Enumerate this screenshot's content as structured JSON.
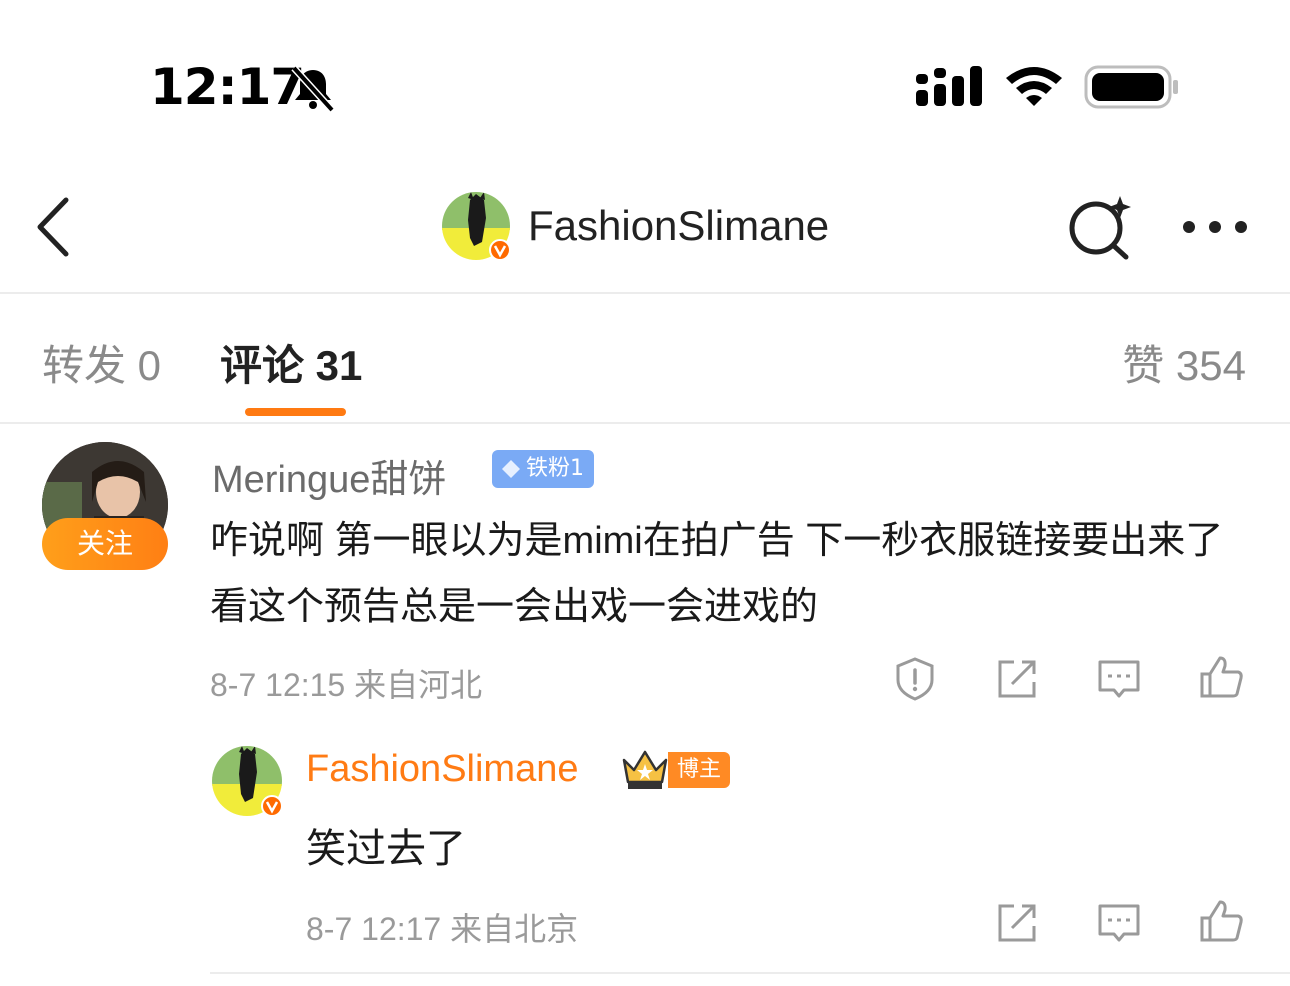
{
  "status_bar": {
    "time": "12:17",
    "icons": [
      "bell-slash-icon",
      "cellular-signal-icon",
      "wifi-icon",
      "battery-icon"
    ]
  },
  "nav": {
    "title": "FashionSlimane",
    "icons": [
      "back-chevron-icon",
      "search-sparkle-icon",
      "more-icon"
    ]
  },
  "tabs": [
    {
      "label": "转发 0",
      "active": false
    },
    {
      "label": "评论 31",
      "active": true
    },
    {
      "label": "赞 354",
      "active": false
    }
  ],
  "colors": {
    "accent": "#ff7a12",
    "verified": "#ff6a00",
    "fan_badge": "#7aaaf5",
    "meta_gray": "#9a9a9a"
  },
  "comment": {
    "username": "Meringue甜饼",
    "fan_badge": "铁粉1",
    "follow_label": "关注",
    "text": "咋说啊 第一眼以为是mimi在拍广告 下一秒衣服链接要出来了 看这个预告总是一会出戏一会进戏的",
    "meta": "8-7 12:15  来自河北",
    "actions": [
      "report-icon",
      "repost-icon",
      "comment-icon",
      "like-icon"
    ],
    "reply": {
      "username": "FashionSlimane",
      "badge": "博主",
      "text": "笑过去了",
      "meta": "8-7 12:17  来自北京",
      "actions": [
        "repost-icon",
        "comment-icon",
        "like-icon"
      ]
    }
  }
}
